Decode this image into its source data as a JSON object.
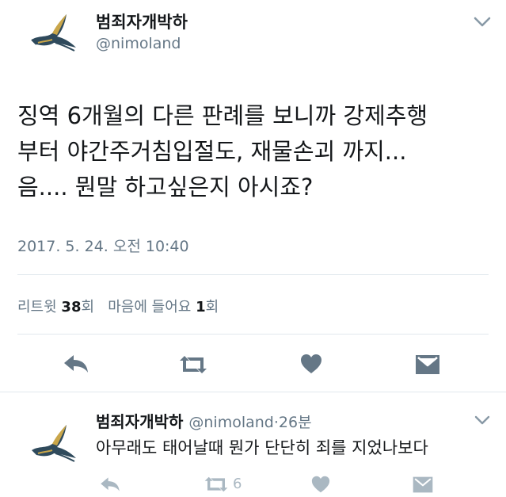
{
  "tweet": {
    "author_name": "범죄자개박하",
    "author_handle": "@nimoland",
    "text_lines": [
      "징역 6개월의 다른 판례를 보니까 강제추행",
      "부터 야간주거침입절도, 재물손괴 까지...",
      "음.... 뭔말 하고싶은지 아시죠?"
    ],
    "timestamp": "2017. 5. 24. 오전 10:40",
    "stats": {
      "retweets_label": "리트윗",
      "retweets_count": "38",
      "retweets_suffix": "회",
      "likes_label": "마음에 들어요",
      "likes_count": "1",
      "likes_suffix": "회"
    },
    "actions": [
      "reply-icon",
      "retweet-icon",
      "heart-icon",
      "message-icon"
    ]
  },
  "reply": {
    "author_name": "범죄자개박하",
    "author_handle": "@nimoland",
    "separator": "·",
    "time": "26분",
    "text": "아무래도 태어날때 뭔가 단단히 죄를 지었나보다",
    "retweet_count": "6",
    "actions": [
      "reply-icon",
      "retweet-icon",
      "heart-icon",
      "message-icon"
    ]
  },
  "colors": {
    "primary_text": "#14171a",
    "secondary_text": "#657786",
    "icon_dark": "#657786",
    "icon_light": "#aab8c2",
    "divider": "#e1e8ed"
  }
}
